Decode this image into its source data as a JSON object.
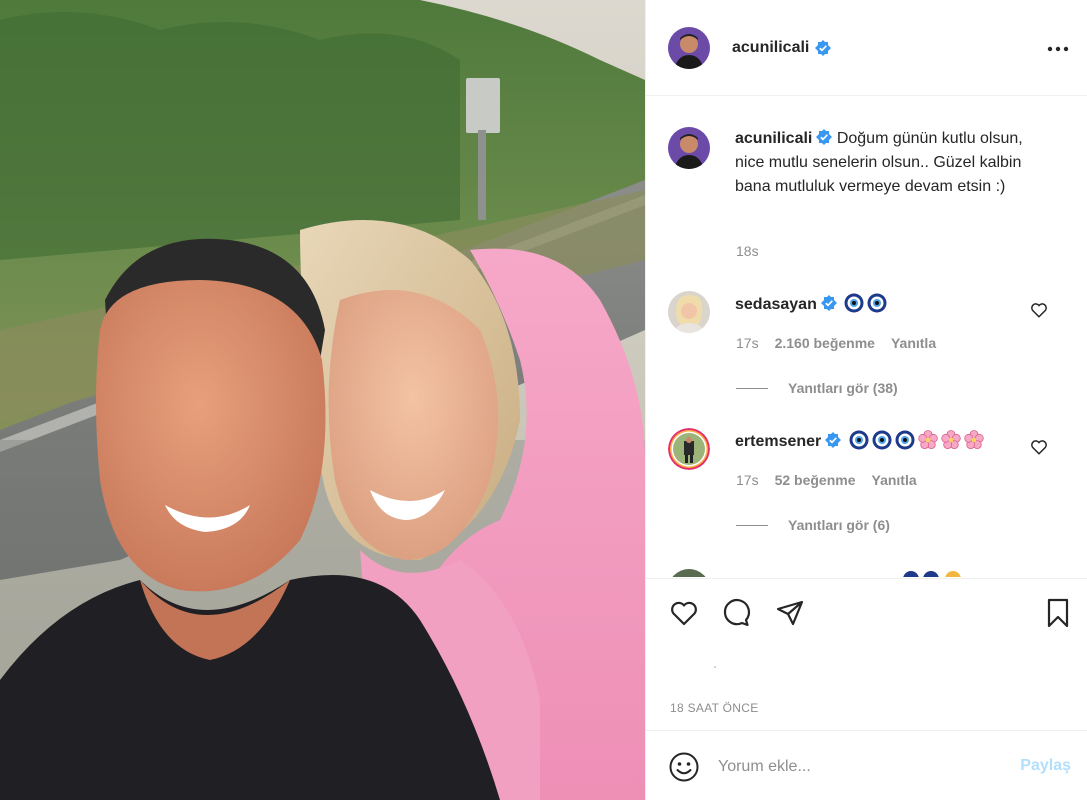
{
  "post": {
    "author": "acunilicali",
    "verified": true,
    "photo_description_icon": "selfie-photo"
  },
  "caption": {
    "username": "acunilicali",
    "text": "Doğum günün kutlu olsun, nice mutlu senelerin olsun.. Güzel kalbin bana mutluluk vermeye devam etsin :)",
    "time": "18s"
  },
  "comments": [
    {
      "username": "sedasayan",
      "verified": true,
      "emojis": [
        "nazar",
        "nazar"
      ],
      "time": "17s",
      "likes": "2.160 beğenme",
      "reply_label": "Yanıtla",
      "view_replies": "Yanıtları gör (38)"
    },
    {
      "username": "ertemsener",
      "verified": true,
      "emojis": [
        "nazar",
        "nazar",
        "nazar",
        "flower",
        "flower",
        "flower"
      ],
      "time": "17s",
      "likes": "52 beğenme",
      "reply_label": "Yanıtla",
      "view_replies": "Yanıtları gör (6)"
    }
  ],
  "actions": {
    "icons": [
      "heart-icon",
      "comment-icon",
      "share-icon",
      "bookmark-icon"
    ],
    "time_ago": "18 saat önce"
  },
  "add_comment": {
    "placeholder": "Yorum ekle...",
    "share_label": "Paylaş"
  },
  "colors": {
    "verified_blue": "#3897f0",
    "share_disabled": "#b2dffc",
    "meta_gray": "#8e8e8e"
  }
}
